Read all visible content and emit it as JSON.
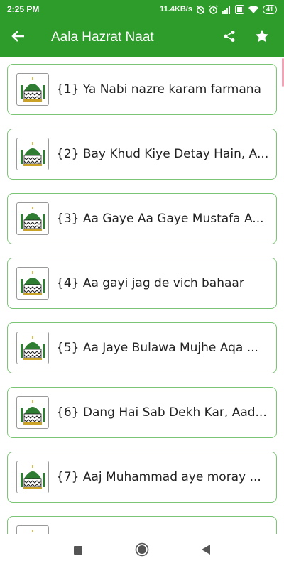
{
  "status_bar": {
    "time": "2:25 PM",
    "net_speed": "11.4KB/s",
    "battery": "41",
    "icons": [
      "alarm-off-icon",
      "alarm-icon",
      "signal-4g-icon",
      "volte-icon",
      "wifi-icon",
      "battery-icon"
    ]
  },
  "app_bar": {
    "title": "Aala Hazrat Naat",
    "color": "#2e9c2b",
    "icons": [
      "back-arrow-icon",
      "share-icon",
      "star-icon"
    ]
  },
  "list": {
    "items": [
      {
        "label": "{1} Ya Nabi nazre karam farmana"
      },
      {
        "label": "{2} Bay Khud Kiye Detay Hain, A..."
      },
      {
        "label": "{3} Aa Gaye Aa Gaye Mustafa A..."
      },
      {
        "label": "{4} Aa gayi jag de vich bahaar"
      },
      {
        "label": "{5} Aa Jaye Bulawa Mujhe Aqa ..."
      },
      {
        "label": "{6} Dang Hai Sab Dekh Kar, Aad..."
      },
      {
        "label": "{7} Aaj Muhammad aye moray ..."
      },
      {
        "label": ""
      }
    ],
    "border_color": "#7cc576"
  },
  "nav_bar": {
    "icons": [
      "recents-square-icon",
      "home-circle-icon",
      "back-triangle-icon"
    ]
  }
}
